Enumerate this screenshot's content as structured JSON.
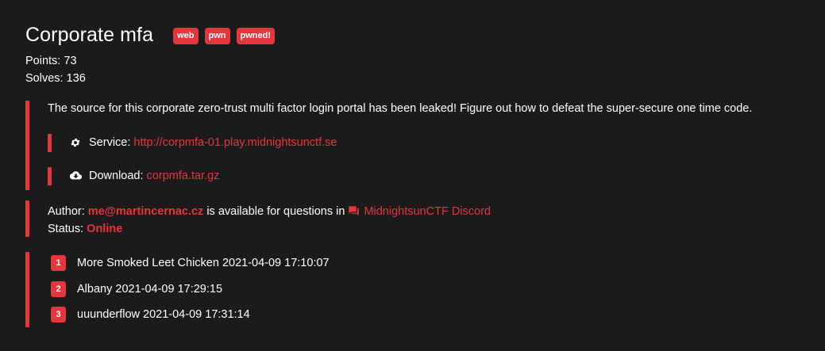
{
  "challenge": {
    "title": "Corporate mfa",
    "tags": [
      "web",
      "pwn",
      "pwned!"
    ],
    "points_label": "Points:",
    "points": "73",
    "solves_label": "Solves:",
    "solves": "136",
    "description": "The source for this corporate zero-trust multi factor login portal has been leaked! Figure out how to defeat the super-secure one time code.",
    "service": {
      "label": "Service:",
      "link": "http://corpmfa-01.play.midnightsunctf.se",
      "icon": "gear-icon"
    },
    "download": {
      "label": "Download:",
      "link": "corpmfa.tar.gz",
      "icon": "cloud-download-icon"
    },
    "author": {
      "label": "Author:",
      "email": "me@martincernac.cz",
      "text": "is available for questions in",
      "discord_icon": "chat-icon",
      "discord": "MidnightsunCTF Discord"
    },
    "status": {
      "label": "Status:",
      "value": "Online"
    },
    "solvers": [
      {
        "rank": "1",
        "team": "More Smoked Leet Chicken",
        "time": "2021-04-09 17:10:07"
      },
      {
        "rank": "2",
        "team": "Albany",
        "time": "2021-04-09 17:29:15"
      },
      {
        "rank": "3",
        "team": "uuunderflow",
        "time": "2021-04-09 17:31:14"
      }
    ]
  },
  "colors": {
    "background": "#1b1b1b",
    "accent": "#e5363e",
    "text": "#ffffff"
  }
}
